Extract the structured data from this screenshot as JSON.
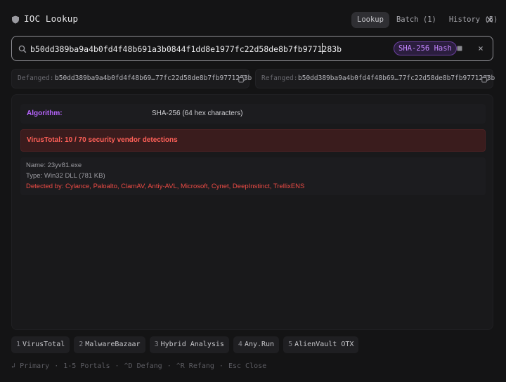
{
  "header": {
    "title": "IOC Lookup",
    "app_icon": "shield-icon",
    "tabs": [
      {
        "label": "Lookup",
        "active": true
      },
      {
        "label": "Batch (1)",
        "active": false
      },
      {
        "label": "History (5)",
        "active": false
      }
    ],
    "close_icon": "close-icon"
  },
  "search": {
    "value": "b50dd389ba9a4b0fd4f48b691a3b0844f1dd8e1977fc22d58de8b7fb9771283b",
    "type_badge": "SHA-256 Hash",
    "icons": [
      "search-icon",
      "stop-icon",
      "clear-icon"
    ]
  },
  "defanged": {
    "label": "Defanged:",
    "value": "b50dd389ba9a4b0fd4f48b69…77fc22d58de8b7fb9771283b"
  },
  "refanged": {
    "label": "Refanged:",
    "value": "b50dd389ba9a4b0fd4f48b69…77fc22d58de8b7fb9771283b"
  },
  "results": {
    "algorithm_label": "Algorithm:",
    "algorithm_value": "SHA-256 (64 hex characters)",
    "virustotal": "VirusTotal: 10 / 70 security vendor detections",
    "file_name": "Name: 23yv81.exe",
    "file_type": "Type: Win32 DLL (781 KB)",
    "detected_by": "Detected by: Cylance, Paloalto, ClamAV, Antiy-AVL, Microsoft, Cynet, DeepInstinct, TrellixENS"
  },
  "portals": [
    {
      "num": "1",
      "name": "VirusTotal"
    },
    {
      "num": "2",
      "name": "MalwareBazaar"
    },
    {
      "num": "3",
      "name": "Hybrid Analysis"
    },
    {
      "num": "4",
      "name": "Any.Run"
    },
    {
      "num": "5",
      "name": "AlienVault OTX"
    }
  ],
  "hints": {
    "enter": "Primary",
    "portals": "1-5 Portals",
    "defang": "^D Defang",
    "refang": "^R Refang",
    "close": "Esc Close"
  },
  "colors": {
    "accent_purple": "#b865ff",
    "alert_red": "#ff6058",
    "background": "#141415"
  }
}
